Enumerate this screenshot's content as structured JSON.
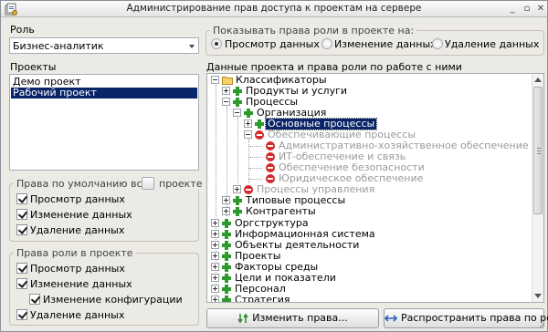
{
  "window": {
    "title": "Администрирование прав доступа к проектам на сервере",
    "controls": [
      "minimize",
      "restore",
      "close"
    ]
  },
  "role": {
    "label": "Роль",
    "selected": "Бизнес-аналитик"
  },
  "show_rights": {
    "label": "Показывать права роли в проекте на:",
    "options": [
      {
        "label": "Просмотр данных",
        "selected": true
      },
      {
        "label": "Изменение данных",
        "selected": false
      },
      {
        "label": "Удаление данных",
        "selected": false
      }
    ]
  },
  "projects": {
    "label": "Проекты",
    "items": [
      {
        "label": "Демо проект",
        "selected": false
      },
      {
        "label": "Рабочий проект",
        "selected": true
      }
    ]
  },
  "default_rights": {
    "title_part1": "Права по умолчанию всех роле",
    "title_part2": "проекте",
    "items": [
      {
        "label": "Просмотр данных",
        "checked": true
      },
      {
        "label": "Изменение данных",
        "checked": true
      },
      {
        "label": "Удаление данных",
        "checked": true
      }
    ]
  },
  "role_rights": {
    "title": "Права роли в проекте",
    "items": [
      {
        "label": "Просмотр данных",
        "checked": true
      },
      {
        "label": "Изменение данных",
        "checked": true
      },
      {
        "label": "Изменение конфигурации",
        "checked": true
      },
      {
        "label": "Удаление данных",
        "checked": true
      }
    ]
  },
  "tree": {
    "label": "Данные проекта и права роли по работе с ними",
    "nodes": [
      {
        "label": "Классификаторы",
        "icon": "folder-icon",
        "toggle": "minus",
        "state": "normal"
      },
      {
        "label": "Продукты и услуги",
        "icon": "plus-icon",
        "toggle": "plus",
        "state": "normal"
      },
      {
        "label": "Процессы",
        "icon": "plus-icon",
        "toggle": "minus",
        "state": "normal"
      },
      {
        "label": "Организация",
        "icon": "plus-icon",
        "toggle": "minus",
        "state": "normal"
      },
      {
        "label": "Основные процессы",
        "icon": "plus-icon",
        "toggle": "plus",
        "state": "selected"
      },
      {
        "label": "Обеспечивающие процессы",
        "icon": "minus-icon",
        "toggle": "minus",
        "state": "disabled"
      },
      {
        "label": "Административно-хозяйственное обеспечение",
        "icon": "minus-icon",
        "toggle": "none",
        "state": "disabled"
      },
      {
        "label": "ИТ-обеспечение и связь",
        "icon": "minus-icon",
        "toggle": "none",
        "state": "disabled"
      },
      {
        "label": "Обеспечение безопасности",
        "icon": "minus-icon",
        "toggle": "none",
        "state": "disabled"
      },
      {
        "label": "Юридическое обеспечение",
        "icon": "minus-icon",
        "toggle": "none",
        "state": "disabled"
      },
      {
        "label": "Процессы управления",
        "icon": "minus-icon",
        "toggle": "plus",
        "state": "disabled"
      },
      {
        "label": "Типовые процессы",
        "icon": "plus-icon",
        "toggle": "plus",
        "state": "normal"
      },
      {
        "label": "Контрагенты",
        "icon": "plus-icon",
        "toggle": "plus",
        "state": "normal"
      },
      {
        "label": "Оргструктура",
        "icon": "plus-icon",
        "toggle": "plus",
        "state": "normal"
      },
      {
        "label": "Информационная система",
        "icon": "plus-icon",
        "toggle": "plus",
        "state": "normal"
      },
      {
        "label": "Объекты деятельности",
        "icon": "plus-icon",
        "toggle": "plus",
        "state": "normal"
      },
      {
        "label": "Проекты",
        "icon": "plus-icon",
        "toggle": "plus",
        "state": "normal"
      },
      {
        "label": "Факторы среды",
        "icon": "plus-icon",
        "toggle": "plus",
        "state": "normal"
      },
      {
        "label": "Цели и показатели",
        "icon": "plus-icon",
        "toggle": "plus",
        "state": "normal"
      },
      {
        "label": "Персонал",
        "icon": "plus-icon",
        "toggle": "plus",
        "state": "normal"
      },
      {
        "label": "Стратегия",
        "icon": "plus-icon",
        "toggle": "plus",
        "state": "normal"
      }
    ]
  },
  "buttons": {
    "change": "Изменить права...",
    "propagate": "Распространить права по ролям"
  }
}
